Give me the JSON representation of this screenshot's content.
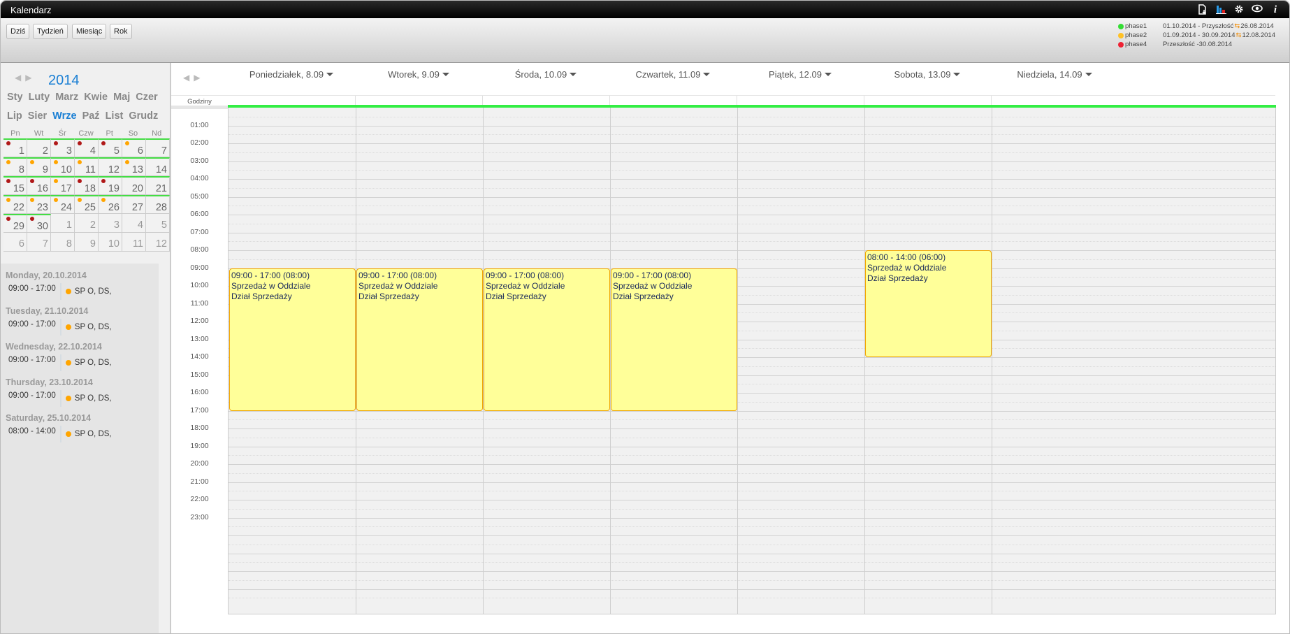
{
  "window": {
    "title": "Kalendarz",
    "icons": [
      "export-icon",
      "chart-icon",
      "gear-icon",
      "eye-icon",
      "info-icon"
    ]
  },
  "toolbar": {
    "buttons": [
      {
        "label": "Dziś"
      },
      {
        "label": "Tydzień"
      },
      {
        "label": "Miesiąc"
      },
      {
        "label": "Rok"
      }
    ]
  },
  "legend": [
    {
      "name": "phase1",
      "color": "#33dd33",
      "range": "01.10.2014 - Przyszłość",
      "swap": "⇆",
      "date": "26.08.2014"
    },
    {
      "name": "phase2",
      "color": "#ffc125",
      "range": "01.09.2014 - 30.09.2014",
      "swap": "⇆",
      "date": "12.08.2014"
    },
    {
      "name": "phase4",
      "color": "#ee2233",
      "range": "Przeszłość -30.08.2014",
      "swap": "",
      "date": ""
    }
  ],
  "minical": {
    "prev": "◀",
    "next": "▶",
    "year": "2014",
    "months_row1": [
      "Sty",
      "Luty",
      "Marz",
      "Kwie",
      "Maj",
      "Czer"
    ],
    "months_row2": [
      "Lip",
      "Sier",
      "Wrze",
      "Paź",
      "List",
      "Grudz"
    ],
    "active_month": "Wrze",
    "weekdays": [
      "Pn",
      "Wt",
      "Śr",
      "Czw",
      "Pt",
      "So",
      "Nd"
    ],
    "days": [
      {
        "d": "1",
        "dot": "red",
        "g": true
      },
      {
        "d": "2",
        "dot": "",
        "g": true
      },
      {
        "d": "3",
        "dot": "red",
        "g": true
      },
      {
        "d": "4",
        "dot": "red",
        "g": true
      },
      {
        "d": "5",
        "dot": "red",
        "g": true
      },
      {
        "d": "6",
        "dot": "orange",
        "g": true
      },
      {
        "d": "7",
        "dot": "",
        "g": true
      },
      {
        "d": "8",
        "dot": "orange",
        "g": true
      },
      {
        "d": "9",
        "dot": "orange",
        "g": true
      },
      {
        "d": "10",
        "dot": "orange",
        "g": true
      },
      {
        "d": "11",
        "dot": "orange",
        "g": true
      },
      {
        "d": "12",
        "dot": "",
        "g": true
      },
      {
        "d": "13",
        "dot": "orange",
        "g": true
      },
      {
        "d": "14",
        "dot": "",
        "g": true
      },
      {
        "d": "15",
        "dot": "red",
        "g": true
      },
      {
        "d": "16",
        "dot": "red",
        "g": true
      },
      {
        "d": "17",
        "dot": "orange",
        "g": true
      },
      {
        "d": "18",
        "dot": "red",
        "g": true
      },
      {
        "d": "19",
        "dot": "red",
        "g": true
      },
      {
        "d": "20",
        "dot": "",
        "g": true
      },
      {
        "d": "21",
        "dot": "",
        "g": true
      },
      {
        "d": "22",
        "dot": "orange",
        "g": true
      },
      {
        "d": "23",
        "dot": "orange",
        "g": true
      },
      {
        "d": "24",
        "dot": "orange",
        "g": true
      },
      {
        "d": "25",
        "dot": "orange",
        "g": true
      },
      {
        "d": "26",
        "dot": "orange",
        "g": true
      },
      {
        "d": "27",
        "dot": "",
        "g": true
      },
      {
        "d": "28",
        "dot": "",
        "g": true
      },
      {
        "d": "29",
        "dot": "red",
        "g": true
      },
      {
        "d": "30",
        "dot": "red",
        "g": true
      },
      {
        "d": "1",
        "dot": "",
        "g": false,
        "other": true
      },
      {
        "d": "2",
        "dot": "",
        "g": false,
        "other": true
      },
      {
        "d": "3",
        "dot": "",
        "g": false,
        "other": true
      },
      {
        "d": "4",
        "dot": "",
        "g": false,
        "other": true
      },
      {
        "d": "5",
        "dot": "",
        "g": false,
        "other": true
      },
      {
        "d": "6",
        "dot": "",
        "g": false,
        "other": true
      },
      {
        "d": "7",
        "dot": "",
        "g": false,
        "other": true
      },
      {
        "d": "8",
        "dot": "",
        "g": false,
        "other": true
      },
      {
        "d": "9",
        "dot": "",
        "g": false,
        "other": true
      },
      {
        "d": "10",
        "dot": "",
        "g": false,
        "other": true
      },
      {
        "d": "11",
        "dot": "",
        "g": false,
        "other": true
      },
      {
        "d": "12",
        "dot": "",
        "g": false,
        "other": true
      }
    ],
    "dot_colors": {
      "red": "#b01818",
      "orange": "#ffa500"
    }
  },
  "agenda": [
    {
      "day": "Monday, 20.10.2014",
      "time": "09:00 - 17:00",
      "text": "SP O, DS,"
    },
    {
      "day": "Tuesday, 21.10.2014",
      "time": "09:00 - 17:00",
      "text": "SP O, DS,"
    },
    {
      "day": "Wednesday, 22.10.2014",
      "time": "09:00 - 17:00",
      "text": "SP O, DS,"
    },
    {
      "day": "Thursday, 23.10.2014",
      "time": "09:00 - 17:00",
      "text": "SP O, DS,"
    },
    {
      "day": "Saturday, 25.10.2014",
      "time": "08:00 - 14:00",
      "text": "SP O, DS,"
    }
  ],
  "week": {
    "prev": "◀",
    "next": "▶",
    "hours_label": "Godziny",
    "days": [
      "Poniedziałek, 8.09",
      "Wtorek, 9.09",
      "Środa, 10.09",
      "Czwartek, 11.09",
      "Piątek, 12.09",
      "Sobota, 13.09",
      "Niedziela, 14.09"
    ],
    "hours": [
      "01:00",
      "02:00",
      "03:00",
      "04:00",
      "05:00",
      "06:00",
      "07:00",
      "08:00",
      "09:00",
      "10:00",
      "11:00",
      "12:00",
      "13:00",
      "14:00",
      "15:00",
      "16:00",
      "17:00",
      "18:00",
      "19:00",
      "20:00",
      "21:00",
      "22:00",
      "23:00"
    ],
    "events": [
      {
        "day": 0,
        "start": 9,
        "end": 17,
        "line1": "09:00 - 17:00 (08:00)",
        "line2": "Sprzedaż w Oddziale",
        "line3": "Dział Sprzedaży"
      },
      {
        "day": 1,
        "start": 9,
        "end": 17,
        "line1": "09:00 - 17:00 (08:00)",
        "line2": "Sprzedaż w Oddziale",
        "line3": "Dział Sprzedaży"
      },
      {
        "day": 2,
        "start": 9,
        "end": 17,
        "line1": "09:00 - 17:00 (08:00)",
        "line2": "Sprzedaż w Oddziale",
        "line3": "Dział Sprzedaży"
      },
      {
        "day": 3,
        "start": 9,
        "end": 17,
        "line1": "09:00 - 17:00 (08:00)",
        "line2": "Sprzedaż w Oddziale",
        "line3": "Dział Sprzedaży"
      },
      {
        "day": 5,
        "start": 8,
        "end": 14,
        "line1": "08:00 - 14:00 (06:00)",
        "line2": "Sprzedaż w Oddziale",
        "line3": "Dział Sprzedaży"
      }
    ]
  }
}
